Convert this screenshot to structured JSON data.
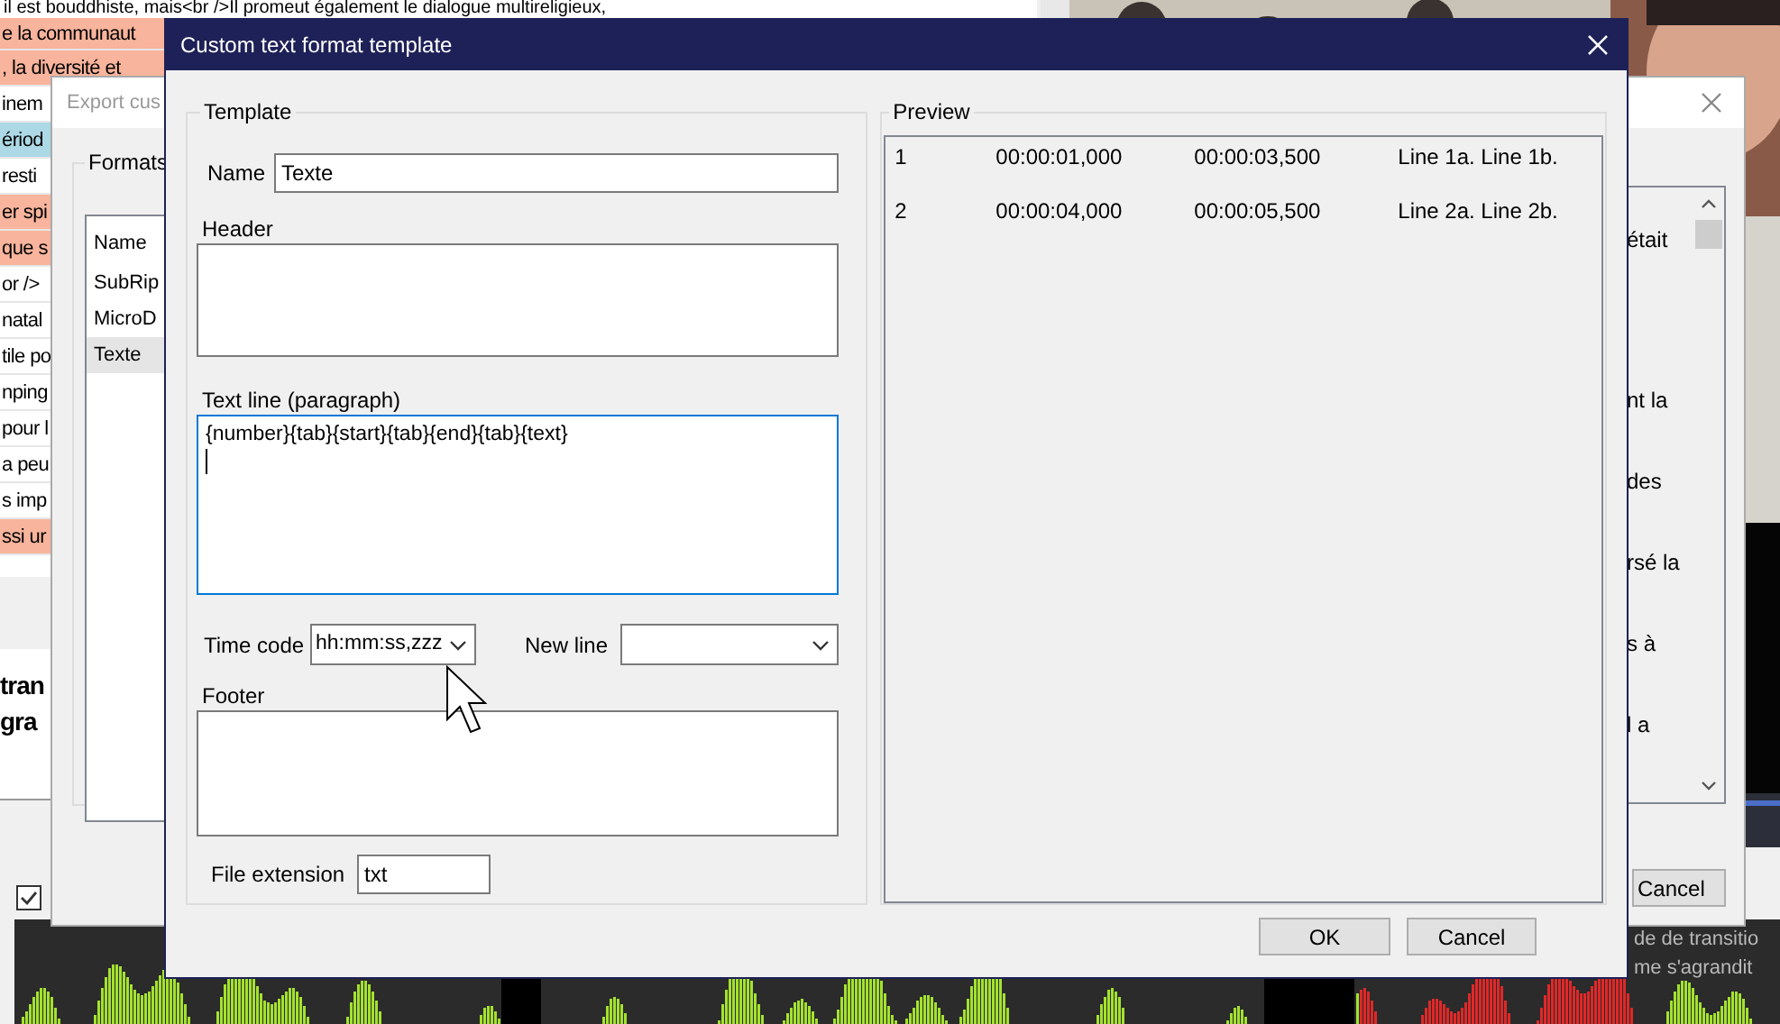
{
  "background": {
    "subtitle_list": {
      "top_line": "il est bouddhiste, mais<br />Il promeut également le dialogue multireligieux,",
      "rows": [
        {
          "text": "e la communaut",
          "color": "#f8b49c"
        },
        {
          "text": ", la diversité et",
          "color": "#f8b49c"
        },
        {
          "text": "inem",
          "color": "#ffffff"
        },
        {
          "text": "ériod",
          "color": "#add8e6"
        },
        {
          "text": "resti",
          "color": "#ffffff"
        },
        {
          "text": "er spi",
          "color": "#f8b49c"
        },
        {
          "text": "que s",
          "color": "#f8b49c"
        },
        {
          "text": "or />",
          "color": "#ffffff"
        },
        {
          "text": "natal",
          "color": "#ffffff"
        },
        {
          "text": "tile po",
          "color": "#ffffff"
        },
        {
          "text": "nping",
          "color": "#ffffff"
        },
        {
          "text": "pour l",
          "color": "#ffffff"
        },
        {
          "text": "a peu",
          "color": "#ffffff"
        },
        {
          "text": "s imp",
          "color": "#ffffff"
        },
        {
          "text": "ssi ur",
          "color": "#f8b49c"
        }
      ]
    },
    "text_preview": [
      "tran",
      "gra"
    ],
    "waveform_checkbox": {
      "checked": true
    },
    "waveform_captions": [
      "de de transitio",
      "me s'agrandit"
    ],
    "export_dialog": {
      "title": "Export cus",
      "formats_group": "Formats",
      "list_header": "Name",
      "formats": [
        {
          "label": "SubRip",
          "selected": false
        },
        {
          "label": "MicroD",
          "selected": false
        },
        {
          "label": "Texte",
          "selected": true
        }
      ],
      "preview_fragments": [
        "était",
        "nt la",
        "des",
        "rsé la",
        "s à",
        "l a"
      ],
      "cancel_button": "Cancel"
    }
  },
  "dialog": {
    "title": "Custom text format template",
    "template": {
      "group_title": "Template",
      "name_label": "Name",
      "name_value": "Texte",
      "header_label": "Header",
      "text_line_label": "Text line (paragraph)",
      "text_line_value": "{number}{tab}{start}{tab}{end}{tab}{text}",
      "time_code_label": "Time code",
      "time_code_value": "hh:mm:ss,zzz",
      "new_line_label": "New line",
      "footer_label": "Footer",
      "file_extension_label": "File extension",
      "file_extension_value": "txt"
    },
    "preview": {
      "group_title": "Preview",
      "rows": [
        {
          "cells": [
            "1",
            "00:00:01,000",
            "00:00:03,500",
            "Line 1a. Line 1b."
          ]
        },
        {
          "cells": [
            "2",
            "00:00:04,000",
            "00:00:05,500",
            "Line 2a. Line 2b."
          ]
        }
      ]
    },
    "buttons": [
      "OK",
      "Cancel"
    ]
  }
}
